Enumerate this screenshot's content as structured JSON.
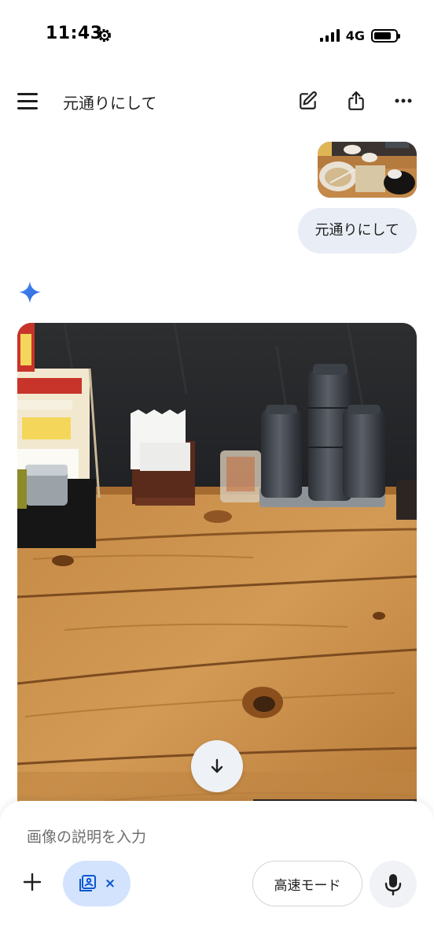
{
  "status_bar": {
    "time": "11:43",
    "network": "4G",
    "icons": [
      "settings-gear-icon",
      "signal-icon",
      "battery-icon"
    ]
  },
  "header": {
    "title": "元通りにして",
    "icons": [
      "menu-icon",
      "edit-icon",
      "share-icon",
      "more-icon"
    ]
  },
  "conversation": {
    "user_message": {
      "text": "元通りにして",
      "attachment": "photo-thumbnail"
    },
    "model_response": {
      "icon": "gemini-sparkle-icon",
      "content": "generated-image"
    },
    "scroll_icon": "arrow-down-icon"
  },
  "composer": {
    "placeholder": "画像の説明を入力",
    "mode_label": "高速モード",
    "chip_icon": "image-icon",
    "chip_close": "×",
    "icons": [
      "plus-icon",
      "image-icon",
      "mic-icon"
    ]
  },
  "colors": {
    "accent_blue": "#0b57d0",
    "chip_bg": "#d3e3fd",
    "bubble_bg": "#e9eef6",
    "wood": "#c98e4a"
  }
}
